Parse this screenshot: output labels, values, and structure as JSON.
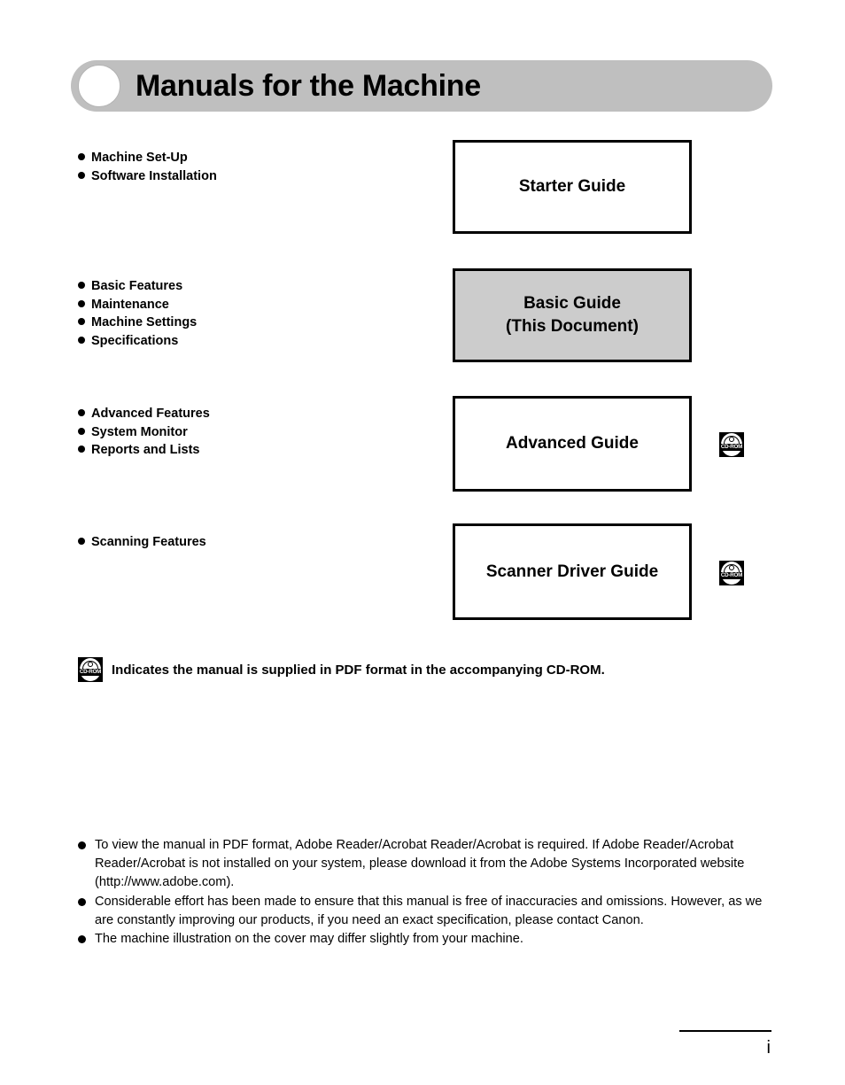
{
  "header": {
    "title": "Manuals for the Machine",
    "banner_color": "#bfbfbf",
    "circle_icon": "circle-bullet-icon"
  },
  "sections": [
    {
      "id": "starter",
      "bullets": [
        "Machine Set-Up",
        "Software Installation"
      ],
      "box_label": "Starter Guide",
      "box_fill": "#ffffff",
      "has_cdrom": false
    },
    {
      "id": "basic",
      "bullets": [
        "Basic Features",
        "Maintenance",
        "Machine Settings",
        "Specifications"
      ],
      "box_label_line1": "Basic Guide",
      "box_label_line2": "(This Document)",
      "box_fill": "#cccccc",
      "has_cdrom": false
    },
    {
      "id": "advanced",
      "bullets": [
        "Advanced Features",
        "System Monitor",
        "Reports and Lists"
      ],
      "box_label": "Advanced Guide",
      "box_fill": "#ffffff",
      "has_cdrom": true
    },
    {
      "id": "scanner",
      "bullets": [
        "Scanning Features"
      ],
      "box_label": "Scanner Driver Guide",
      "box_fill": "#ffffff",
      "has_cdrom": true
    }
  ],
  "cdrom_icon": {
    "label": "CD-ROM",
    "name": "cd-rom-icon"
  },
  "legend": {
    "text": "Indicates the manual is supplied in PDF format in the accompanying CD-ROM."
  },
  "notes": [
    "To view the manual in PDF format, Adobe Reader/Acrobat Reader/Acrobat is required. If Adobe Reader/Acrobat Reader/Acrobat is not installed on your system, please download it from the Adobe Systems Incorporated website (http://www.adobe.com).",
    "Considerable effort has been made to ensure that this manual is free of inaccuracies and omissions. However, as we are constantly improving our products, if you need an exact specification, please contact Canon.",
    "The machine illustration on the cover may differ slightly from your machine."
  ],
  "footer": {
    "page_number": "i"
  }
}
